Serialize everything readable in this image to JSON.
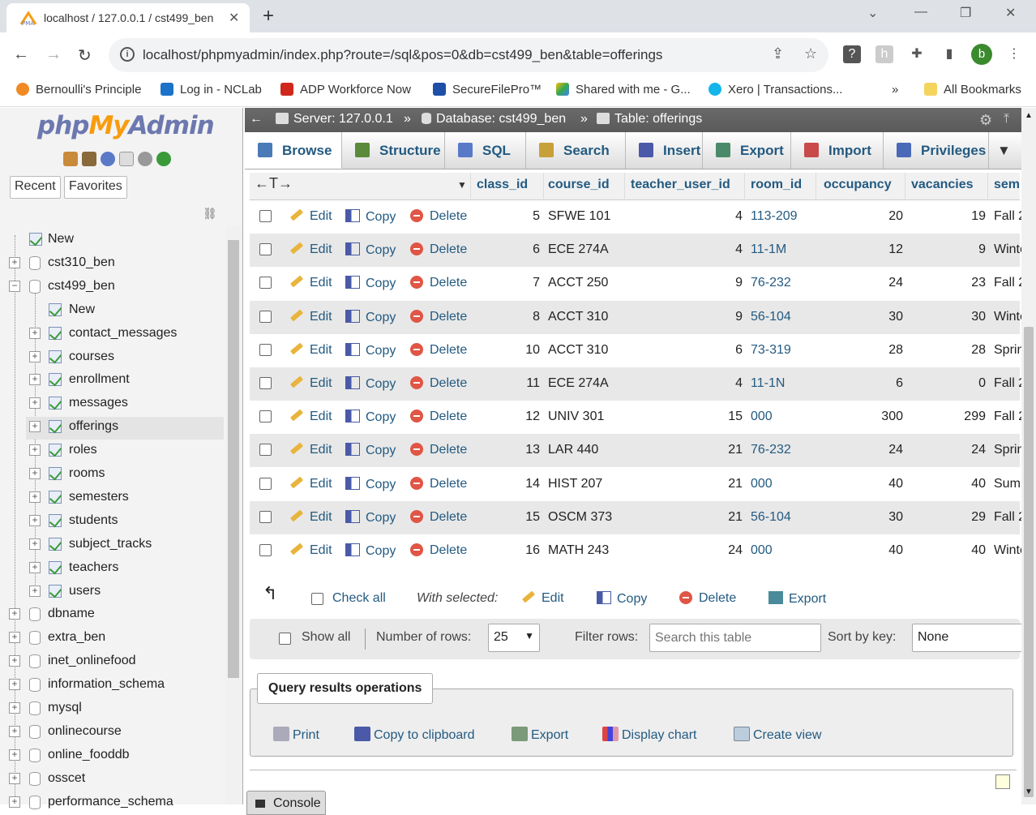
{
  "browser": {
    "tab_title": "localhost / 127.0.0.1 / cst499_ben",
    "url": "localhost/phpmyadmin/index.php?route=/sql&pos=0&db=cst499_ben&table=offerings",
    "profile_initial": "b",
    "bookmarks": [
      "Bernoulli's Principle",
      "Log in - NCLab",
      "ADP Workforce Now",
      "SecureFilePro™",
      "Shared with me - G...",
      "Xero | Transactions..."
    ],
    "bookmarks_more": "»",
    "all_bookmarks": "All Bookmarks"
  },
  "logo": {
    "php": "php",
    "my": "My",
    "admin": "Admin"
  },
  "nav": {
    "recent": "Recent",
    "favorites": "Favorites",
    "tree": [
      {
        "label": "New",
        "level": 0
      },
      {
        "label": "cst310_ben",
        "level": 0
      },
      {
        "label": "cst499_ben",
        "level": 0
      },
      {
        "label": "New",
        "level": 1
      },
      {
        "label": "contact_messages",
        "level": 1
      },
      {
        "label": "courses",
        "level": 1
      },
      {
        "label": "enrollment",
        "level": 1
      },
      {
        "label": "messages",
        "level": 1
      },
      {
        "label": "offerings",
        "level": 1
      },
      {
        "label": "roles",
        "level": 1
      },
      {
        "label": "rooms",
        "level": 1
      },
      {
        "label": "semesters",
        "level": 1
      },
      {
        "label": "students",
        "level": 1
      },
      {
        "label": "subject_tracks",
        "level": 1
      },
      {
        "label": "teachers",
        "level": 1
      },
      {
        "label": "users",
        "level": 1
      },
      {
        "label": "dbname",
        "level": 0
      },
      {
        "label": "extra_ben",
        "level": 0
      },
      {
        "label": "inet_onlinefood",
        "level": 0
      },
      {
        "label": "information_schema",
        "level": 0
      },
      {
        "label": "mysql",
        "level": 0
      },
      {
        "label": "onlinecourse",
        "level": 0
      },
      {
        "label": "online_fooddb",
        "level": 0
      },
      {
        "label": "osscet",
        "level": 0
      },
      {
        "label": "performance_schema",
        "level": 0
      }
    ]
  },
  "breadcrumb": {
    "server": "Server: 127.0.0.1",
    "database": "Database: cst499_ben",
    "table": "Table: offerings",
    "sep": "»"
  },
  "tabs": [
    "Browse",
    "Structure",
    "SQL",
    "Search",
    "Insert",
    "Export",
    "Import",
    "Privileges"
  ],
  "columns": [
    "class_id",
    "course_id",
    "teacher_user_id",
    "room_id",
    "occupancy",
    "vacancies",
    "sem"
  ],
  "actions": {
    "edit": "Edit",
    "copy": "Copy",
    "delete": "Delete"
  },
  "rows": [
    {
      "class_id": "5",
      "course_id": "SFWE 101",
      "teacher_user_id": "4",
      "room_id": "113-209",
      "occupancy": "20",
      "vacancies": "19",
      "sem": "Fall 2"
    },
    {
      "class_id": "6",
      "course_id": "ECE 274A",
      "teacher_user_id": "4",
      "room_id": "11-1M",
      "occupancy": "12",
      "vacancies": "9",
      "sem": "Winte"
    },
    {
      "class_id": "7",
      "course_id": "ACCT 250",
      "teacher_user_id": "9",
      "room_id": "76-232",
      "occupancy": "24",
      "vacancies": "23",
      "sem": "Fall 2"
    },
    {
      "class_id": "8",
      "course_id": "ACCT 310",
      "teacher_user_id": "9",
      "room_id": "56-104",
      "occupancy": "30",
      "vacancies": "30",
      "sem": "Winte"
    },
    {
      "class_id": "10",
      "course_id": "ACCT 310",
      "teacher_user_id": "6",
      "room_id": "73-319",
      "occupancy": "28",
      "vacancies": "28",
      "sem": "Sprin"
    },
    {
      "class_id": "11",
      "course_id": "ECE 274A",
      "teacher_user_id": "4",
      "room_id": "11-1N",
      "occupancy": "6",
      "vacancies": "0",
      "sem": "Fall 2"
    },
    {
      "class_id": "12",
      "course_id": "UNIV 301",
      "teacher_user_id": "15",
      "room_id": "000",
      "occupancy": "300",
      "vacancies": "299",
      "sem": "Fall 2"
    },
    {
      "class_id": "13",
      "course_id": "LAR 440",
      "teacher_user_id": "21",
      "room_id": "76-232",
      "occupancy": "24",
      "vacancies": "24",
      "sem": "Sprin"
    },
    {
      "class_id": "14",
      "course_id": "HIST 207",
      "teacher_user_id": "21",
      "room_id": "000",
      "occupancy": "40",
      "vacancies": "40",
      "sem": "Sum"
    },
    {
      "class_id": "15",
      "course_id": "OSCM 373",
      "teacher_user_id": "21",
      "room_id": "56-104",
      "occupancy": "30",
      "vacancies": "29",
      "sem": "Fall 2"
    },
    {
      "class_id": "16",
      "course_id": "MATH 243",
      "teacher_user_id": "24",
      "room_id": "000",
      "occupancy": "40",
      "vacancies": "40",
      "sem": "Winte"
    }
  ],
  "footer": {
    "check_all": "Check all",
    "with_selected": "With selected:",
    "edit": "Edit",
    "copy": "Copy",
    "delete": "Delete",
    "export": "Export"
  },
  "controls": {
    "show_all": "Show all",
    "num_rows_label": "Number of rows:",
    "num_rows": "25",
    "filter_label": "Filter rows:",
    "filter_placeholder": "Search this table",
    "sort_label": "Sort by key:",
    "sort_value": "None"
  },
  "qro": {
    "title": "Query results operations",
    "print": "Print",
    "copy": "Copy to clipboard",
    "export": "Export",
    "chart": "Display chart",
    "view": "Create view"
  },
  "console": "Console"
}
